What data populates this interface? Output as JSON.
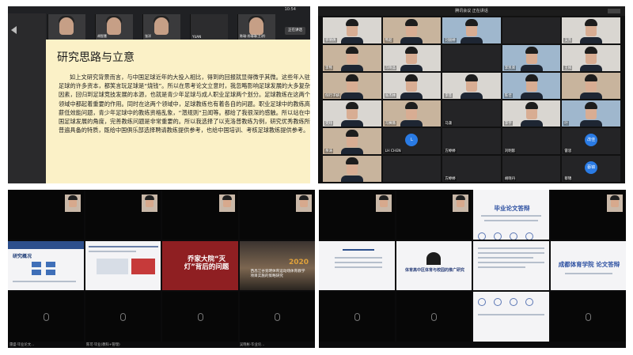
{
  "panel1": {
    "status_time": "10:54",
    "participants": [
      {
        "name": ""
      },
      {
        "name": "胡智慧"
      },
      {
        "name": "张洋"
      },
      {
        "name": "YUAN"
      },
      {
        "name": "陈瑞·肖瑞瑞(主讲)"
      }
    ],
    "right_button": "正在讲话",
    "slide": {
      "title": "研究思路与立意",
      "body": "如上文研究背景而言，与中国足球近年的大投入相比，得到的回报就显得微乎其微。这些年入驻足球的许多资本，都笑言玩足球是“烧钱”。所以在思考论文立意时，我忽略影响足球发展的大多复杂因素，回归到足球竞技发展的本源，也就是青少年足球与成人职业足球两个划分。足球教练在这两个领域中都起着重要的作用。同时在这两个领域中，足球教练也有着各自的问题。职业足球中的教练高薪低效能问题，青少年足球中的教练资格乱象，“潜规则”丑闻等。都给了我很深的感触。所以站在中国足球发展的角度，完善教练问题是非常重要的。所以我选择了以克洛普教练为例，研究优秀教练所普遍具备的特质，既给中国俱乐部选择聘请教练提供参考，也给中国培训、考核足球教练提供参考。"
    }
  },
  "panel2": {
    "title": "腾讯会议 正在讲话",
    "tiles": [
      {
        "label": "郭倩倩"
      },
      {
        "label": "熊超"
      },
      {
        "label": "刘丽婷"
      },
      {
        "label": ""
      },
      {
        "label": "吴凯"
      },
      {
        "label": "李熊"
      },
      {
        "label": "冯晓晶"
      },
      {
        "label": ""
      },
      {
        "label": "李凯荣"
      },
      {
        "label": "王婉"
      },
      {
        "label": "倪行子妍"
      },
      {
        "label": "张杰林"
      },
      {
        "label": "李芸"
      },
      {
        "label": "陈佳"
      },
      {
        "label": ""
      },
      {
        "label": "樊翔"
      },
      {
        "label": "冯赛薇"
      },
      {
        "label": "马潇"
      },
      {
        "label": "李宇"
      },
      {
        "label": "叶"
      },
      {
        "label": "余涛"
      },
      {
        "label": "LH CHEN"
      },
      {
        "label": "方婷婷"
      },
      {
        "label": "刘明影"
      },
      {
        "label": "雷思"
      },
      {
        "label": ""
      },
      {
        "label": ""
      },
      {
        "label": "方婷婷"
      },
      {
        "label": "胡晓丹"
      },
      {
        "label": "蔡锦"
      }
    ],
    "avatar_l": "L",
    "avatar_a": "改佳",
    "avatar_b": "蔡锦"
  },
  "panel3": {
    "slides": {
      "s1_title": "研究概况",
      "s3_title": "乔家大院“灭灯”背后的问题",
      "s4_year": "2020",
      "s4_title": "西昌江谷宽明体育运动场体育教学项目实施的策略研究"
    },
    "bottom_labels": [
      "雷盛·毕业论文...",
      "陈可·毕业(教科+管理)",
      "",
      "吴晓彬·毕业论..."
    ]
  },
  "panel4": {
    "slides": {
      "s2_title": "体育高中区体育与校园的推广研究",
      "s3_heading": "毕业论文答辩",
      "s4_heading": "成都体育学院 论文答辩"
    },
    "bottom_labels": [
      "",
      "",
      "",
      ""
    ]
  }
}
